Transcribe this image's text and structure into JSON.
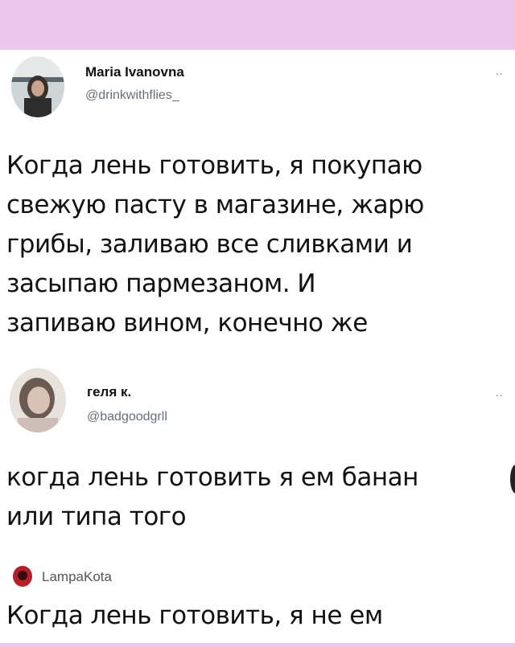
{
  "posts": [
    {
      "author_name": "Maria Ivanovna",
      "handle": "@drinkwithflies_",
      "more_label": "..",
      "text": "Когда лень готовить, я покупаю\nсвежую пасту в магазине, жарю\nгрибы, заливаю все сливками и\nзасыпаю пармезаном. И\nзапиваю вином, конечно же"
    },
    {
      "author_name": "геля к.",
      "handle": "@badgoodgrll",
      "more_label": "..",
      "text": "когда лень готовить я ем банан\nили типа того"
    }
  ],
  "reply": {
    "author_name": "LampaKota",
    "text": "Когда лень готовить, я не ем"
  },
  "colors": {
    "band": "#ecc8ec",
    "handle": "#66707a"
  }
}
